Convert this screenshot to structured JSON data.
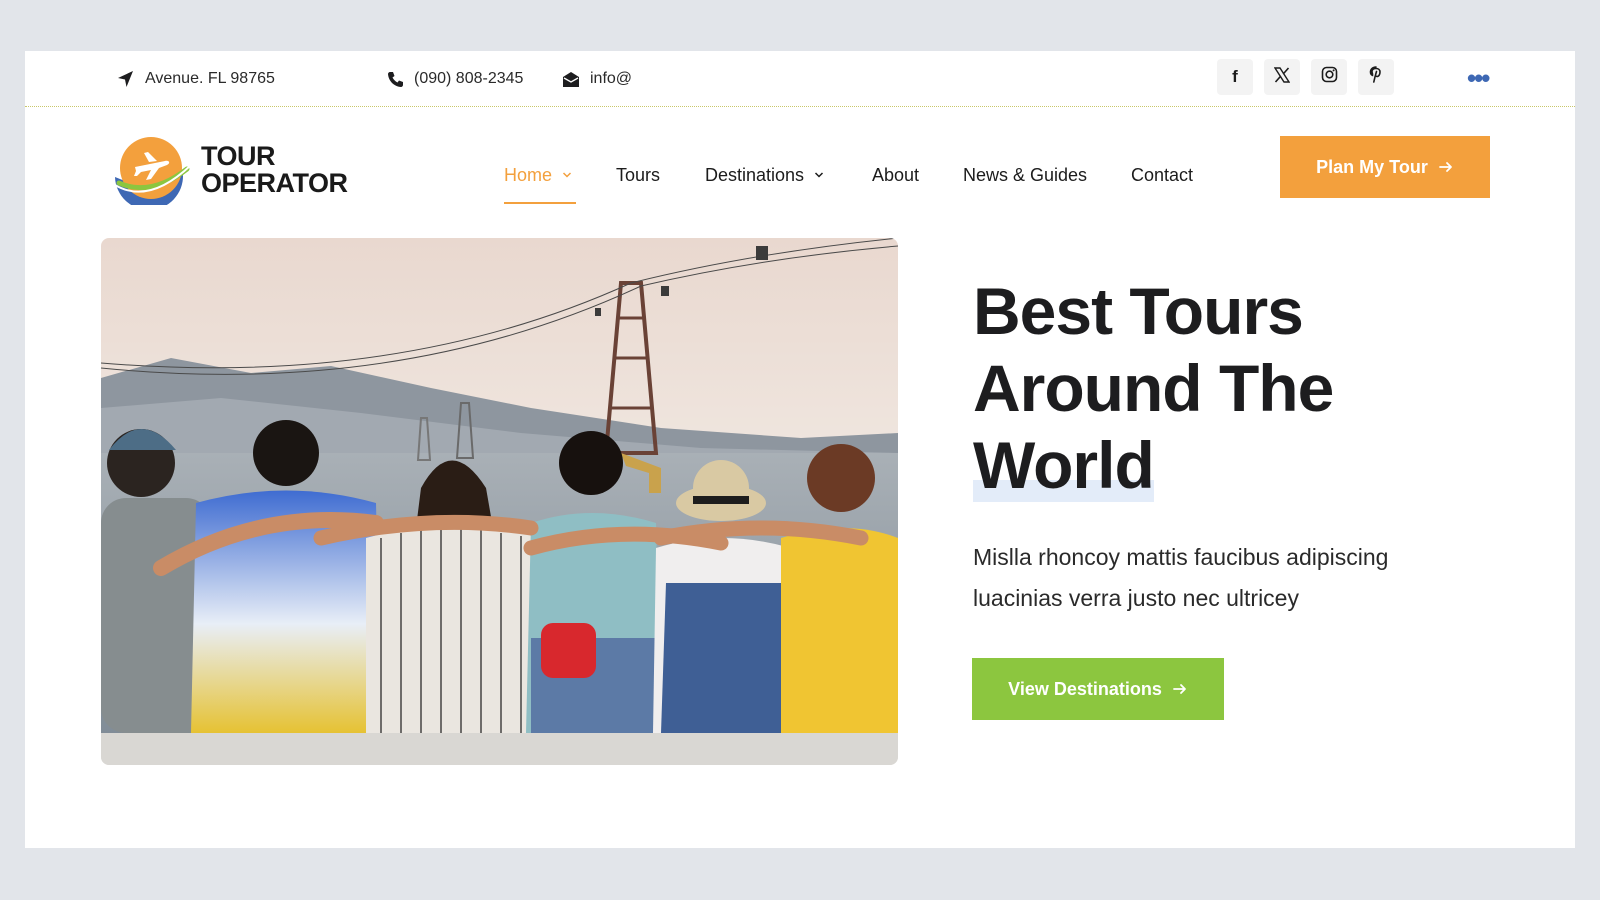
{
  "topbar": {
    "address": "Avenue. FL 98765",
    "phone": "(090) 808-2345",
    "email": "info@",
    "social": [
      {
        "icon": "facebook-icon",
        "glyph": "f"
      },
      {
        "icon": "x-icon",
        "glyph": "𝕏"
      },
      {
        "icon": "instagram-icon",
        "glyph": ""
      },
      {
        "icon": "pinterest-icon",
        "glyph": "P"
      }
    ],
    "more_glyph": "•••"
  },
  "logo": {
    "line1": "TOUR",
    "line2": "OPERATOR"
  },
  "nav": {
    "items": [
      {
        "label": "Home",
        "active": true,
        "has_dropdown": true
      },
      {
        "label": "Tours",
        "active": false,
        "has_dropdown": false
      },
      {
        "label": "Destinations",
        "active": false,
        "has_dropdown": true
      },
      {
        "label": "About",
        "active": false,
        "has_dropdown": false
      },
      {
        "label": "News & Guides",
        "active": false,
        "has_dropdown": false
      },
      {
        "label": "Contact",
        "active": false,
        "has_dropdown": false
      }
    ],
    "cta_label": "Plan My Tour"
  },
  "hero": {
    "headline_line1": "Best Tours",
    "headline_line2": "Around The",
    "headline_line3": "World",
    "subtitle": "Mislla rhoncoy mattis faucibus adipiscing luacinias verra justo nec ultricey",
    "button_label": "View Destinations"
  },
  "colors": {
    "accent_orange": "#f3a03d",
    "accent_green": "#8cc63f",
    "social_blue": "#3e68b4",
    "text_dark": "#1d1d1f"
  }
}
